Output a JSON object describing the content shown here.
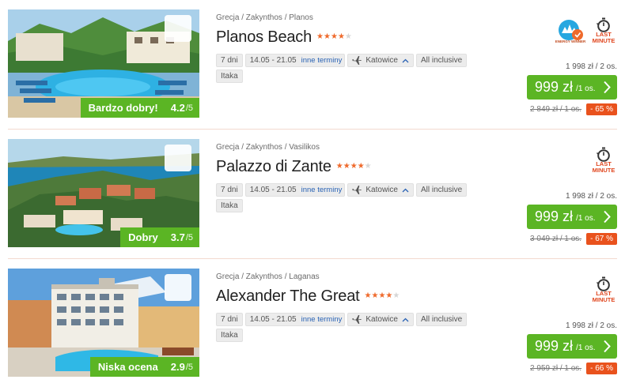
{
  "offers": [
    {
      "breadcrumb": "Grecja / Zakynthos / Planos",
      "name": "Planos Beach",
      "stars": 4,
      "rating_label": "Bardzo dobry!",
      "rating_score": "4.2",
      "rating_max": "/5",
      "duration": "7 dni",
      "dates": "14.05 - 21.05",
      "other_dates": "inne terminy",
      "departure": "Katowice",
      "board": "All inclusive",
      "operator": "Itaka",
      "trophy_label": "ENERGY WINNER",
      "last_minute": [
        "LAST",
        "MINUTE"
      ],
      "total_price": "1 998 zł / 2 os.",
      "price": "999 zł",
      "price_unit": "/1 os.",
      "old_price": "2 849 zł / 1 os.",
      "discount": "- 65 %"
    },
    {
      "breadcrumb": "Grecja / Zakynthos / Vasilikos",
      "name": "Palazzo di Zante",
      "stars": 4,
      "rating_label": "Dobry",
      "rating_score": "3.7",
      "rating_max": "/5",
      "duration": "7 dni",
      "dates": "14.05 - 21.05",
      "other_dates": "inne terminy",
      "departure": "Katowice",
      "board": "All inclusive",
      "operator": "Itaka",
      "last_minute": [
        "LAST",
        "MINUTE"
      ],
      "total_price": "1 998 zł / 2 os.",
      "price": "999 zł",
      "price_unit": "/1 os.",
      "old_price": "3 049 zł / 1 os.",
      "discount": "- 67 %"
    },
    {
      "breadcrumb": "Grecja / Zakynthos / Laganas",
      "name": "Alexander The Great",
      "stars": 4,
      "rating_label": "Niska ocena",
      "rating_score": "2.9",
      "rating_max": "/5",
      "duration": "7 dni",
      "dates": "14.05 - 21.05",
      "other_dates": "inne terminy",
      "departure": "Katowice",
      "board": "All inclusive",
      "operator": "Itaka",
      "last_minute": [
        "LAST",
        "MINUTE"
      ],
      "total_price": "1 998 zł / 2 os.",
      "price": "999 zł",
      "price_unit": "/1 os.",
      "old_price": "2 959 zł / 1 os.",
      "discount": "- 66 %"
    }
  ],
  "colors": {
    "accent_green": "#5bb524",
    "discount_orange": "#e9521d",
    "star_orange": "#ef6a2c",
    "link_blue": "#2a63b5"
  },
  "icons": {
    "favorite": "heart-icon",
    "departure": "airplane-icon",
    "expand": "chevron-up-icon",
    "last_minute": "stopwatch-icon",
    "book": "chevron-right-icon"
  }
}
